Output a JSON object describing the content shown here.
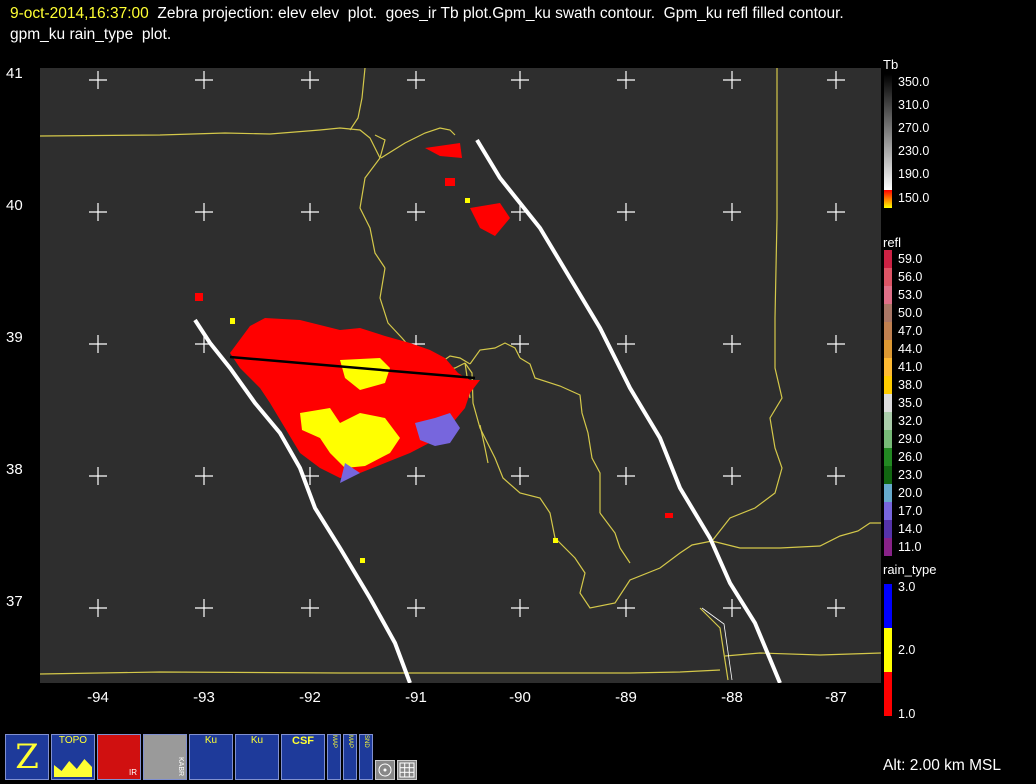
{
  "title": {
    "timestamp": "9-oct-2014,16:37:00",
    "line1_rest": "  Zebra projection: elev elev  plot.  goes_ir Tb plot.Gpm_ku swath contour.  Gpm_ku refl filled contour.",
    "line2": "gpm_ku rain_type  plot."
  },
  "map": {
    "y_ticks": [
      "41",
      "40",
      "39",
      "38",
      "37"
    ],
    "x_ticks": [
      "-94",
      "-93",
      "-92",
      "-91",
      "-90",
      "-89",
      "-88",
      "-87"
    ]
  },
  "legends": {
    "tb": {
      "title": "Tb",
      "labels": [
        "350.0",
        "310.0",
        "270.0",
        "230.0",
        "190.0",
        "150.0"
      ]
    },
    "refl": {
      "title": "refl",
      "labels": [
        "59.0",
        "56.0",
        "53.0",
        "50.0",
        "47.0",
        "44.0",
        "41.0",
        "38.0",
        "35.0",
        "32.0",
        "29.0",
        "26.0",
        "23.0",
        "20.0",
        "17.0",
        "14.0",
        "11.0"
      ],
      "colors": [
        "#cc2244",
        "#dd5566",
        "#e07088",
        "#aa7766",
        "#c08050",
        "#dd9933",
        "#ffbb33",
        "#ffcc00",
        "#dddddd",
        "#aaccaa",
        "#77bb77",
        "#228822",
        "#116611",
        "#66aacc",
        "#7766dd",
        "#5533aa",
        "#882288"
      ]
    },
    "rain_type": {
      "title": "rain_type",
      "labels": [
        "3.0",
        "2.0",
        "1.0"
      ],
      "colors": [
        "#0000ff",
        "#ffff00",
        "#ff0000"
      ]
    }
  },
  "toolbar": {
    "buttons": [
      {
        "name": "zebra-icon",
        "label": "Z"
      },
      {
        "name": "topo-button",
        "label": "TOPO"
      },
      {
        "name": "goes-ir-button",
        "label": "IR"
      },
      {
        "name": "kaber-button",
        "label": "KABR"
      },
      {
        "name": "ku-gpm-button-1",
        "label": "Ku"
      },
      {
        "name": "ku-gpm-button-2",
        "label": "Ku"
      },
      {
        "name": "csf-gpm-button",
        "label": "CSF"
      },
      {
        "name": "map-button-1",
        "label": "MAP"
      },
      {
        "name": "map-button-2",
        "label": "MAP"
      },
      {
        "name": "sounds-button",
        "label": "SND"
      }
    ]
  },
  "altitude": "Alt: 2.00 km MSL"
}
